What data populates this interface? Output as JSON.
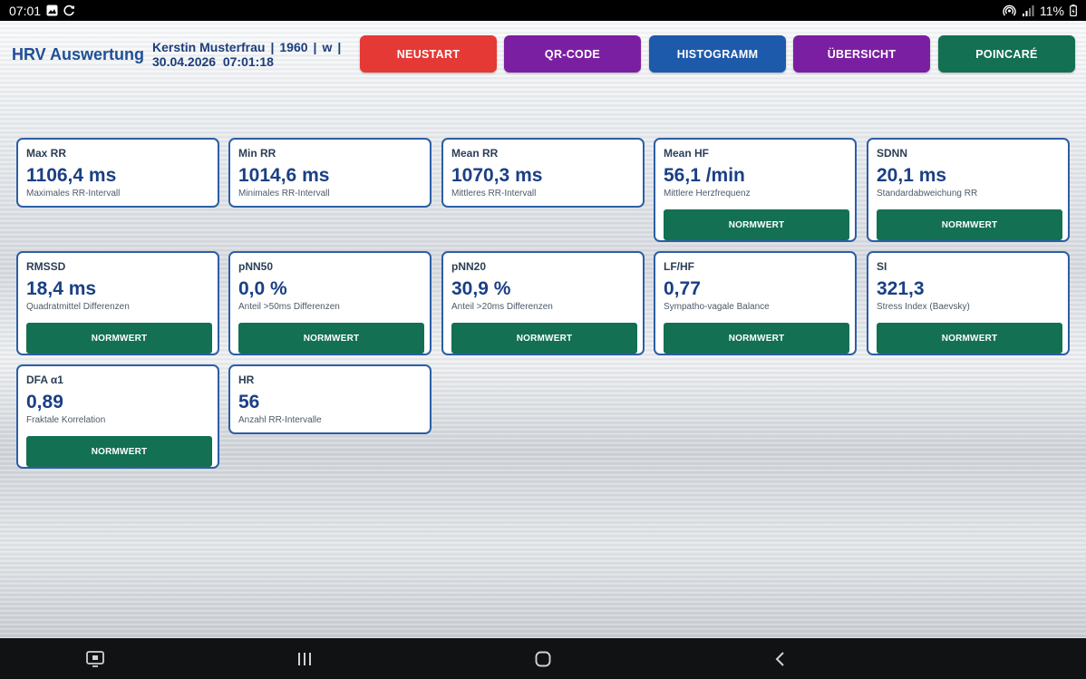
{
  "status_bar": {
    "time": "07:01",
    "battery": "11%",
    "left_icons": [
      "image-icon",
      "sync-icon"
    ],
    "right_icons": [
      "hotspot-icon",
      "signal-icon",
      "battery-icon"
    ]
  },
  "header": {
    "title": "HRV Auswertung",
    "patient_name": "Kerstin Musterfrau",
    "birth_year": "1960",
    "sex": "w",
    "separator": "|",
    "date": "30.04.2026",
    "time": "07:01:18"
  },
  "buttons": [
    {
      "label": "NEUSTART",
      "color": "#e53935"
    },
    {
      "label": "QR-CODE",
      "color": "#7b1fa2"
    },
    {
      "label": "HISTOGRAMM",
      "color": "#1e5aab"
    },
    {
      "label": "ÜBERSICHT",
      "color": "#7b1fa2"
    },
    {
      "label": "POINCARÉ",
      "color": "#137052"
    }
  ],
  "norm_label": "NORMWERT",
  "metrics": [
    {
      "label": "Max RR",
      "value": "1106,4 ms",
      "desc": "Maximales RR-Intervall",
      "has_norm": false
    },
    {
      "label": "Min RR",
      "value": "1014,6 ms",
      "desc": "Minimales RR-Intervall",
      "has_norm": false
    },
    {
      "label": "Mean RR",
      "value": "1070,3 ms",
      "desc": "Mittleres RR-Intervall",
      "has_norm": false
    },
    {
      "label": "Mean HF",
      "value": "56,1 /min",
      "desc": "Mittlere Herzfrequenz",
      "has_norm": true
    },
    {
      "label": "SDNN",
      "value": "20,1 ms",
      "desc": "Standardabweichung RR",
      "has_norm": true
    },
    {
      "label": "RMSSD",
      "value": "18,4 ms",
      "desc": "Quadratmittel Differenzen",
      "has_norm": true
    },
    {
      "label": "pNN50",
      "value": "0,0 %",
      "desc": "Anteil >50ms Differenzen",
      "has_norm": true
    },
    {
      "label": "pNN20",
      "value": "30,9 %",
      "desc": "Anteil >20ms Differenzen",
      "has_norm": true
    },
    {
      "label": "LF/HF",
      "value": "0,77",
      "desc": "Sympatho-vagale Balance",
      "has_norm": true
    },
    {
      "label": "SI",
      "value": "321,3",
      "desc": "Stress Index (Baevsky)",
      "has_norm": true
    },
    {
      "label": "DFA α1",
      "value": "0,89",
      "desc": "Fraktale Korrelation",
      "has_norm": true
    },
    {
      "label": "HR",
      "value": "56",
      "desc": "Anzahl RR-Intervalle",
      "has_norm": false
    }
  ],
  "nav_bar": {
    "icons": [
      "screenshot-icon",
      "recent-apps-icon",
      "home-icon",
      "back-icon"
    ]
  }
}
